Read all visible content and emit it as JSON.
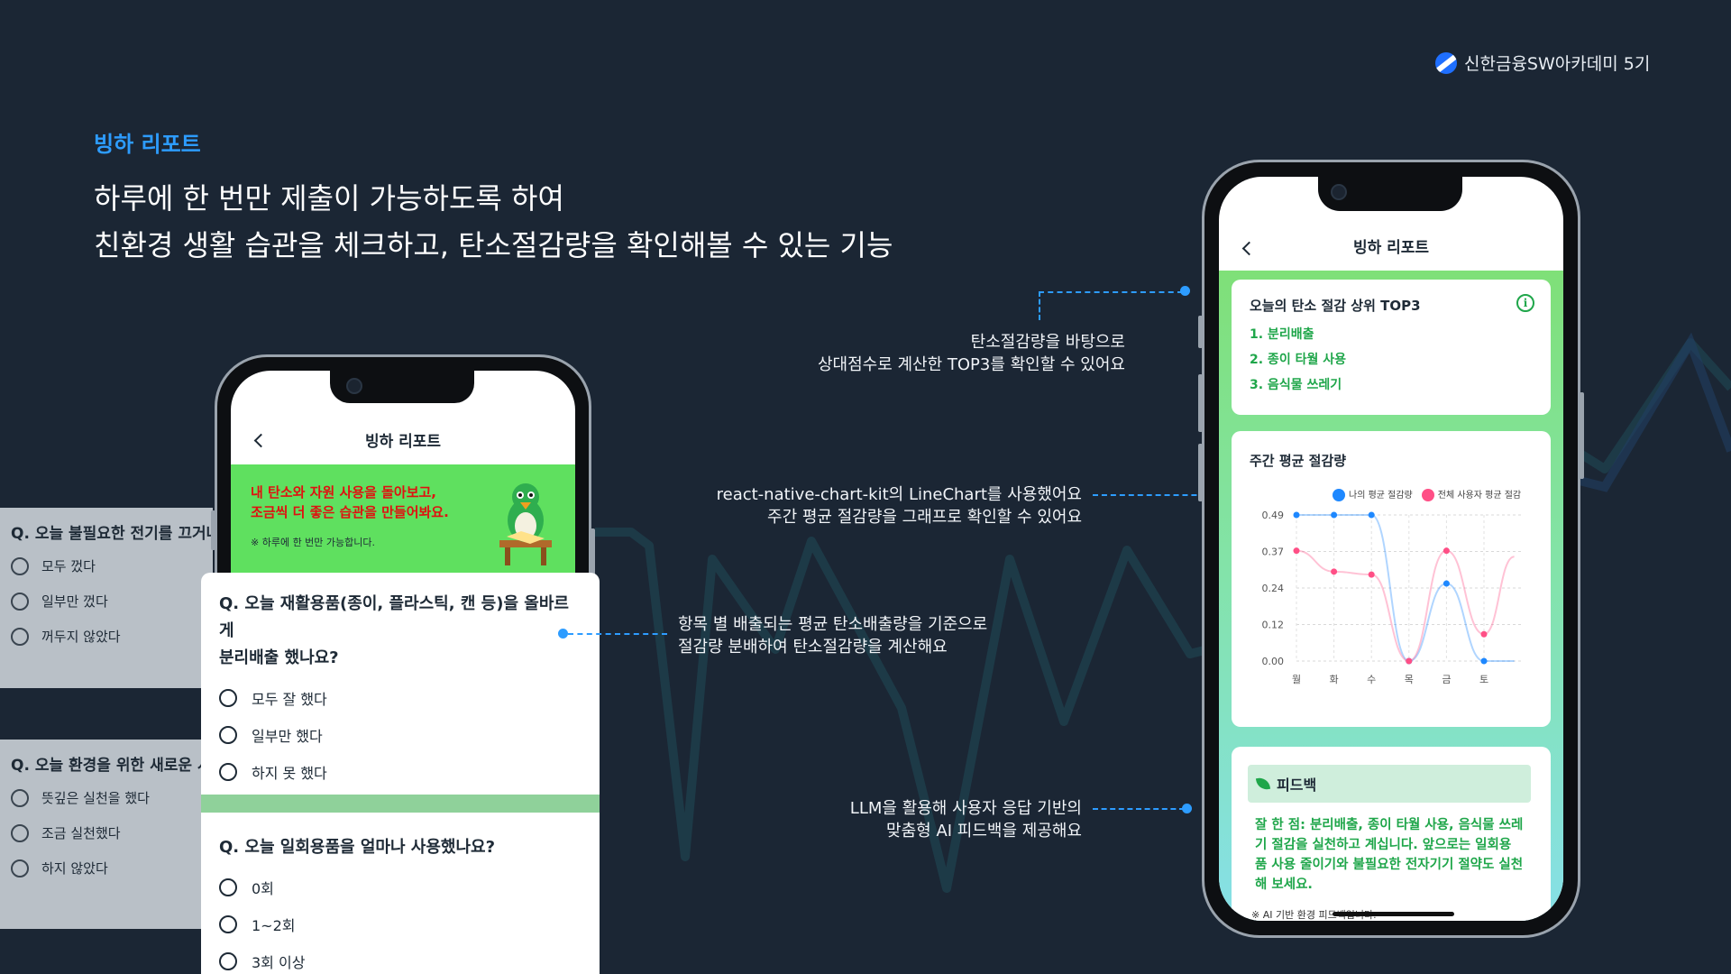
{
  "header": {
    "brand": "신한금융SW아카데미 5기",
    "section_label": "빙하 리포트",
    "headline_line1": "하루에 한 번만 제출이 가능하도록 하여",
    "headline_line2": "친환경 생활 습관을 체크하고, 탄소절감량을 확인해볼 수 있는 기능"
  },
  "annotations": {
    "top3_line1": "탄소절감량을 바탕으로",
    "top3_line2": "상대점수로 계산한 TOP3를 확인할 수 있어요",
    "chart_line1": "react-native-chart-kit의 LineChart를 사용했어요",
    "chart_line2": "주간 평균 절감량을 그래프로 확인할 수 있어요",
    "calc_line1": "항목 별 배출되는 평균 탄소배출량을 기준으로",
    "calc_line2": "절감량 분배하여 탄소절감량을 계산해요",
    "llm_line1": "LLM을 활용해 사용자 응답 기반의",
    "llm_line2": "맞춤형 AI 피드백을 제공해요"
  },
  "left_phone": {
    "title": "빙하 리포트",
    "banner_line1": "내 탄소와 자원 사용을 돌아보고,",
    "banner_line2": "조금씩 더 좋은 습관을 만들어봐요.",
    "banner_note": "※ 하루에 한 번만 가능합니다."
  },
  "ghost_cards": [
    {
      "question": "Q. 오늘 불필요한 전기를 끄거나",
      "options": [
        "모두 껐다",
        "일부만 껐다",
        "꺼두지 않았다"
      ]
    },
    {
      "question": "Q. 오늘 환경을 위한 새로운 시",
      "options": [
        "뜻깊은 실천을 했다",
        "조금 실천했다",
        "하지 않았다"
      ]
    }
  ],
  "question_cards": [
    {
      "question_line1": "Q. 오늘 재활용품(종이, 플라스틱, 캔 등)을 올바르게",
      "question_line2": "분리배출 했나요?",
      "options": [
        "모두 잘 했다",
        "일부만 했다",
        "하지 못 했다"
      ]
    },
    {
      "question_line1": "Q. 오늘 일회용품을 얼마나 사용했나요?",
      "options": [
        "0회",
        "1~2회",
        "3회 이상"
      ]
    }
  ],
  "right_phone": {
    "title": "빙하 리포트",
    "top3_title": "오늘의 탄소 절감 상위 TOP3",
    "top3_items": [
      "1. 분리배출",
      "2. 종이 타월 사용",
      "3. 음식물 쓰레기"
    ],
    "weekly_title": "주간 평균 절감량",
    "feedback_title": "피드백",
    "feedback_line1": "잘 한 점: 분리배출, 종이 타월 사용, 음식물 쓰레",
    "feedback_line2": "기 절감을 실천하고 계십니다. 앞으로는 일회용",
    "feedback_line3": "품 사용 줄이기와 불필요한 전자기기 절약도 실천",
    "feedback_line4": "해 보세요.",
    "feedback_note": "※ AI 기반 환경 피드백입니다."
  },
  "chart_data": {
    "type": "line",
    "categories": [
      "월",
      "화",
      "수",
      "목",
      "금",
      "토"
    ],
    "yticks": [
      "0.49",
      "0.37",
      "0.24",
      "0.12",
      "0.00"
    ],
    "ylim": [
      0,
      0.49
    ],
    "legend_position": "top",
    "series": [
      {
        "name": "나의 평균 절감량",
        "color": "#1e88ff",
        "values": [
          0.49,
          0.49,
          0.49,
          0.0,
          0.26,
          0.0
        ]
      },
      {
        "name": "전체 사용자 평균 절감",
        "color": "#ff4f86",
        "values": [
          0.37,
          0.3,
          0.29,
          0.0,
          0.37,
          0.09
        ]
      }
    ],
    "tail": [
      0.0,
      0.35
    ]
  },
  "colors": {
    "accent": "#2d9cff",
    "banner_green": "#5fe05f",
    "banner_text": "#e01010",
    "positive_text": "#1fa64a"
  }
}
